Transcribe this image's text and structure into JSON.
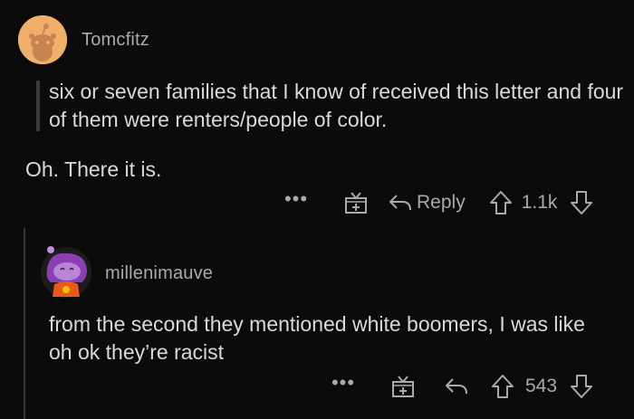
{
  "comments": [
    {
      "username": "Tomcfitz",
      "quote": "six or seven families that I know of received this letter and four of them were renters/people of color.",
      "body": "Oh. There it is.",
      "actions": {
        "more": "•••",
        "reply_label": "Reply",
        "score": "1.1k"
      }
    },
    {
      "username": "millenimauve",
      "body": "from the second they mentioned white boomers, I was like oh ok they’re racist",
      "actions": {
        "more": "•••",
        "score": "543"
      }
    }
  ],
  "icons": {
    "more": "more-dots-icon",
    "award": "gift-award-icon",
    "reply": "reply-arrow-icon",
    "upvote": "upvote-arrow-icon",
    "downvote": "downvote-arrow-icon"
  },
  "colors": {
    "background": "#0b0b0b",
    "text": "#d7dadc",
    "muted": "#a8aaab",
    "avatar1": "#f0b06a",
    "avatar2_hair": "#8a3fb3"
  }
}
